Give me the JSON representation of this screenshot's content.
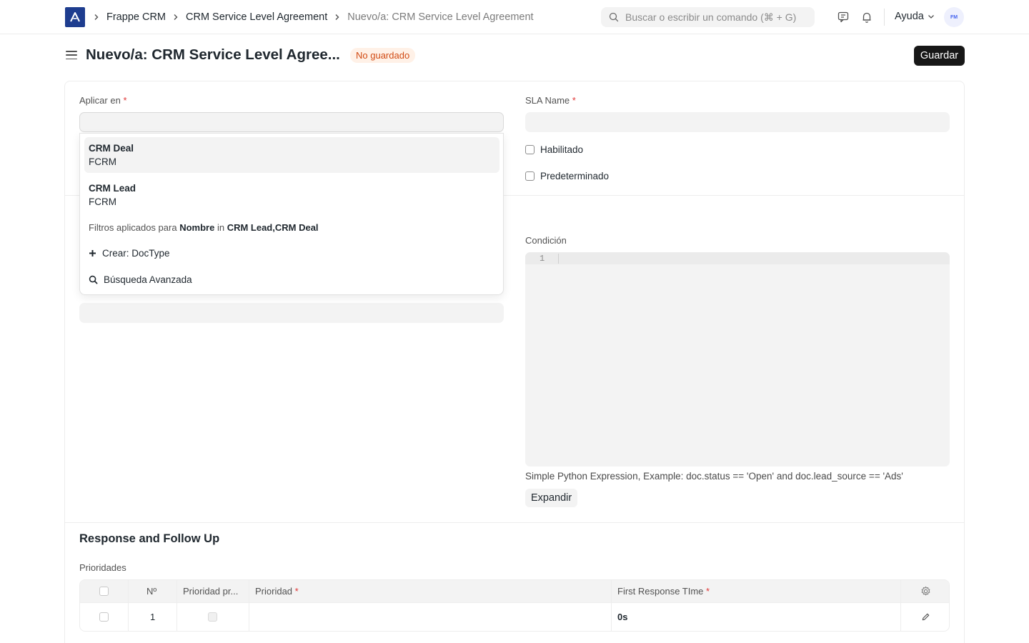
{
  "navbar": {
    "breadcrumbs": [
      "Frappe CRM",
      "CRM Service Level Agreement",
      "Nuevo/a: CRM Service Level Agreement"
    ],
    "search_placeholder": "Buscar o escribir un comando (⌘ + G)",
    "help_label": "Ayuda",
    "avatar_text": "FM"
  },
  "page": {
    "title": "Nuevo/a: CRM Service Level Agree...",
    "status_badge": "No guardado",
    "save_label": "Guardar"
  },
  "form": {
    "apply_on_label": "Aplicar en",
    "sla_name_label": "SLA Name",
    "enabled_label": "Habilitado",
    "default_label": "Predeterminado",
    "condition_label": "Condición",
    "condition_line_number": "1",
    "condition_description": "Simple Python Expression, Example: doc.status == 'Open' and doc.lead_source == 'Ads'",
    "expand_label": "Expandir",
    "required_mark": "*"
  },
  "section": {
    "title": "Response and Follow Up",
    "priorities_label": "Prioridades"
  },
  "priorities_table": {
    "columns": [
      "Nº",
      "Prioridad pr...",
      "Prioridad",
      "First Response TIme"
    ],
    "rows": [
      {
        "no": "1",
        "priority": "",
        "first_response_time": "0s"
      }
    ]
  },
  "dropdown": {
    "items": [
      {
        "title": "CRM Deal",
        "subtitle": "FCRM"
      },
      {
        "title": "CRM Lead",
        "subtitle": "FCRM"
      }
    ],
    "filter_prefix": "Filtros aplicados para",
    "filter_field": "Nombre",
    "filter_op": "in",
    "filter_value": "CRM Lead,CRM Deal",
    "create_label": "Crear: DocType",
    "advanced_search_label": "Búsqueda Avanzada"
  },
  "colors": {
    "logo_bg": "#1e3d8f",
    "badge_bg": "#fff1e7",
    "badge_text": "#d14a13",
    "primary_button": "#171717",
    "required": "#e03636"
  }
}
